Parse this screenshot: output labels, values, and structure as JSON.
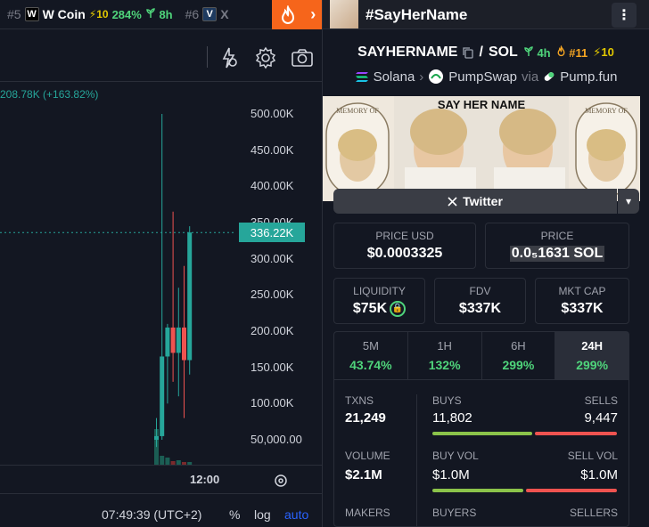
{
  "ticker": {
    "items": [
      {
        "rank": "#5",
        "logo": "W",
        "name": "W Coin",
        "boost": "⚡10",
        "pct": "284%",
        "age": "8h"
      },
      {
        "rank": "#6",
        "logo": "V",
        "name": "X"
      }
    ]
  },
  "chart": {
    "legend": "208.78K (+163.82%)",
    "price_labels": [
      "500.00K",
      "450.00K",
      "400.00K",
      "350.00K",
      "300.00K",
      "250.00K",
      "200.00K",
      "150.00K",
      "100.00K",
      "50,000.00"
    ],
    "current_price": "336.22K",
    "time_label": "12:00",
    "clock": "07:49:39 (UTC+2)",
    "pct_btn": "%",
    "log_btn": "log",
    "auto_btn": "auto"
  },
  "chart_data": {
    "type": "candlestick",
    "y_ticks": [
      500000,
      450000,
      400000,
      350000,
      300000,
      250000,
      200000,
      150000,
      100000,
      50000
    ],
    "current_price": 336220,
    "candles": [
      {
        "open": 50000,
        "high": 80000,
        "low": 40000,
        "close": 55000
      },
      {
        "open": 55000,
        "high": 500000,
        "low": 50000,
        "close": 165000
      },
      {
        "open": 165000,
        "high": 210000,
        "low": 100000,
        "close": 205000
      },
      {
        "open": 205000,
        "high": 365000,
        "low": 130000,
        "close": 170000
      },
      {
        "open": 170000,
        "high": 260000,
        "low": 110000,
        "close": 205000
      },
      {
        "open": 205000,
        "high": 290000,
        "low": 80000,
        "close": 160000
      },
      {
        "open": 160000,
        "high": 345000,
        "low": 140000,
        "close": 336220
      }
    ],
    "volumes": [
      40,
      10,
      8,
      4,
      5,
      3,
      3
    ]
  },
  "header": {
    "title": "#SayHerName"
  },
  "pair": {
    "base": "SAYHERNAME",
    "sep": "/",
    "quote": "SOL",
    "age": "4h",
    "rank": "#11",
    "boost": "10",
    "chain": "Solana",
    "dex": "PumpSwap",
    "via": "via",
    "launchpad": "Pump.fun"
  },
  "banner": {
    "headline": "SAY HER NAME",
    "memory_text": "MEMORY OF"
  },
  "twitter": {
    "label": "Twitter"
  },
  "prices": {
    "usd_label": "PRICE USD",
    "usd_value": "$0.0003325",
    "price_label": "PRICE",
    "price_value": "0.0₅1631 SOL"
  },
  "metrics": [
    {
      "label": "LIQUIDITY",
      "value": "$75K"
    },
    {
      "label": "FDV",
      "value": "$337K"
    },
    {
      "label": "MKT CAP",
      "value": "$337K"
    }
  ],
  "timeframes": [
    {
      "label": "5M",
      "value": "43.74%"
    },
    {
      "label": "1H",
      "value": "132%"
    },
    {
      "label": "6H",
      "value": "299%"
    },
    {
      "label": "24H",
      "value": "299%"
    }
  ],
  "stats": {
    "txns_label": "TXNS",
    "txns_value": "21,249",
    "buys_label": "BUYS",
    "buys_value": "11,802",
    "sells_label": "SELLS",
    "sells_value": "9,447",
    "volume_label": "VOLUME",
    "volume_value": "$2.1M",
    "buyvol_label": "BUY VOL",
    "buyvol_value": "$1.0M",
    "sellvol_label": "SELL VOL",
    "sellvol_value": "$1.0M",
    "makers_label": "MAKERS",
    "buyers_label": "BUYERS",
    "sellers_label": "SELLERS"
  }
}
